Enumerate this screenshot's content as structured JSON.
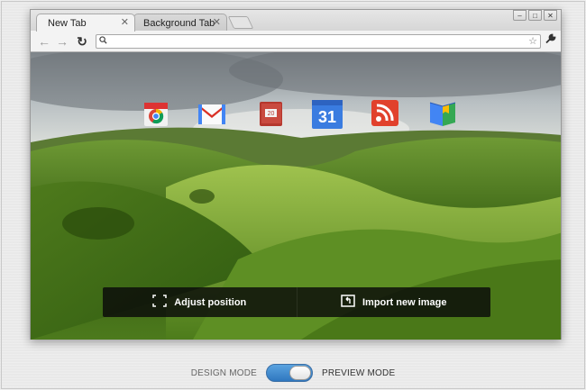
{
  "browser": {
    "tabs": [
      {
        "label": "New Tab",
        "active": true
      },
      {
        "label": "Background Tab",
        "active": false
      }
    ],
    "tab_close": "✕",
    "window_controls": {
      "minimize": "–",
      "maximize": "□",
      "close": "✕"
    },
    "nav": {
      "back": "←",
      "forward": "→",
      "reload": "↻"
    },
    "omnibox": {
      "value": "",
      "search_icon": "🔍",
      "star_icon": "☆"
    },
    "wrench_icon": "🔧"
  },
  "apps": [
    {
      "name": "Chrome Web Store"
    },
    {
      "name": "Gmail"
    },
    {
      "name": "Calendar Book",
      "label": "20"
    },
    {
      "name": "Google Calendar",
      "label": "31"
    },
    {
      "name": "RSS Reader"
    },
    {
      "name": "Google Books"
    }
  ],
  "actions": {
    "adjust": "Adjust position",
    "import": "Import new image"
  },
  "mode": {
    "design": "DESIGN MODE",
    "preview": "PREVIEW MODE",
    "selected": "preview"
  },
  "colors": {
    "toggle_on": "#3b86d1",
    "action_bar": "#111111"
  }
}
